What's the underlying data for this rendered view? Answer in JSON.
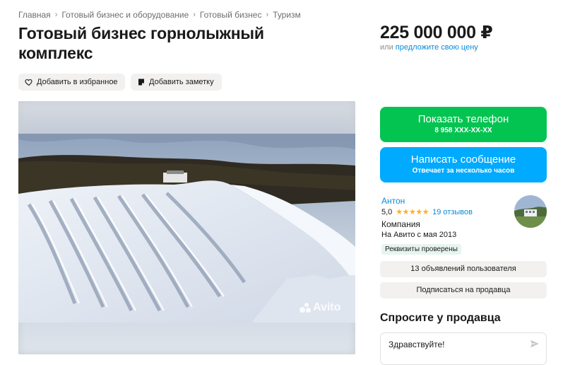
{
  "breadcrumbs": [
    "Главная",
    "Готовый бизнес и оборудование",
    "Готовый бизнес",
    "Туризм"
  ],
  "title": "Готовый бизнес горнолыжный комплекс",
  "price": "225 000 000 ₽",
  "price_sub": {
    "prefix": "или ",
    "link": "предложите свою цену"
  },
  "actions": {
    "favorite": "Добавить в избранное",
    "note": "Добавить заметку"
  },
  "gallery": {
    "watermark": "Avito"
  },
  "contact": {
    "phone_label": "Показать телефон",
    "phone_number": "8 958 XXX-XX-XX",
    "message_label": "Написать сообщение",
    "message_sub": "Отвечает за несколько часов"
  },
  "seller": {
    "name": "Антон",
    "rating": "5,0",
    "stars": "★★★★★",
    "reviews": "19 отзывов",
    "type": "Компания",
    "since": "На Авито с мая 2013",
    "verified": "Реквизиты проверены",
    "ads_button": "13 объявлений пользователя",
    "subscribe_button": "Подписаться на продавца"
  },
  "ask": {
    "title": "Спросите у продавца",
    "message": "Здравствуйте!"
  },
  "colors": {
    "green": "#04c451",
    "blue": "#00aaff",
    "link": "#0a8cd9",
    "star": "#ffb021"
  }
}
